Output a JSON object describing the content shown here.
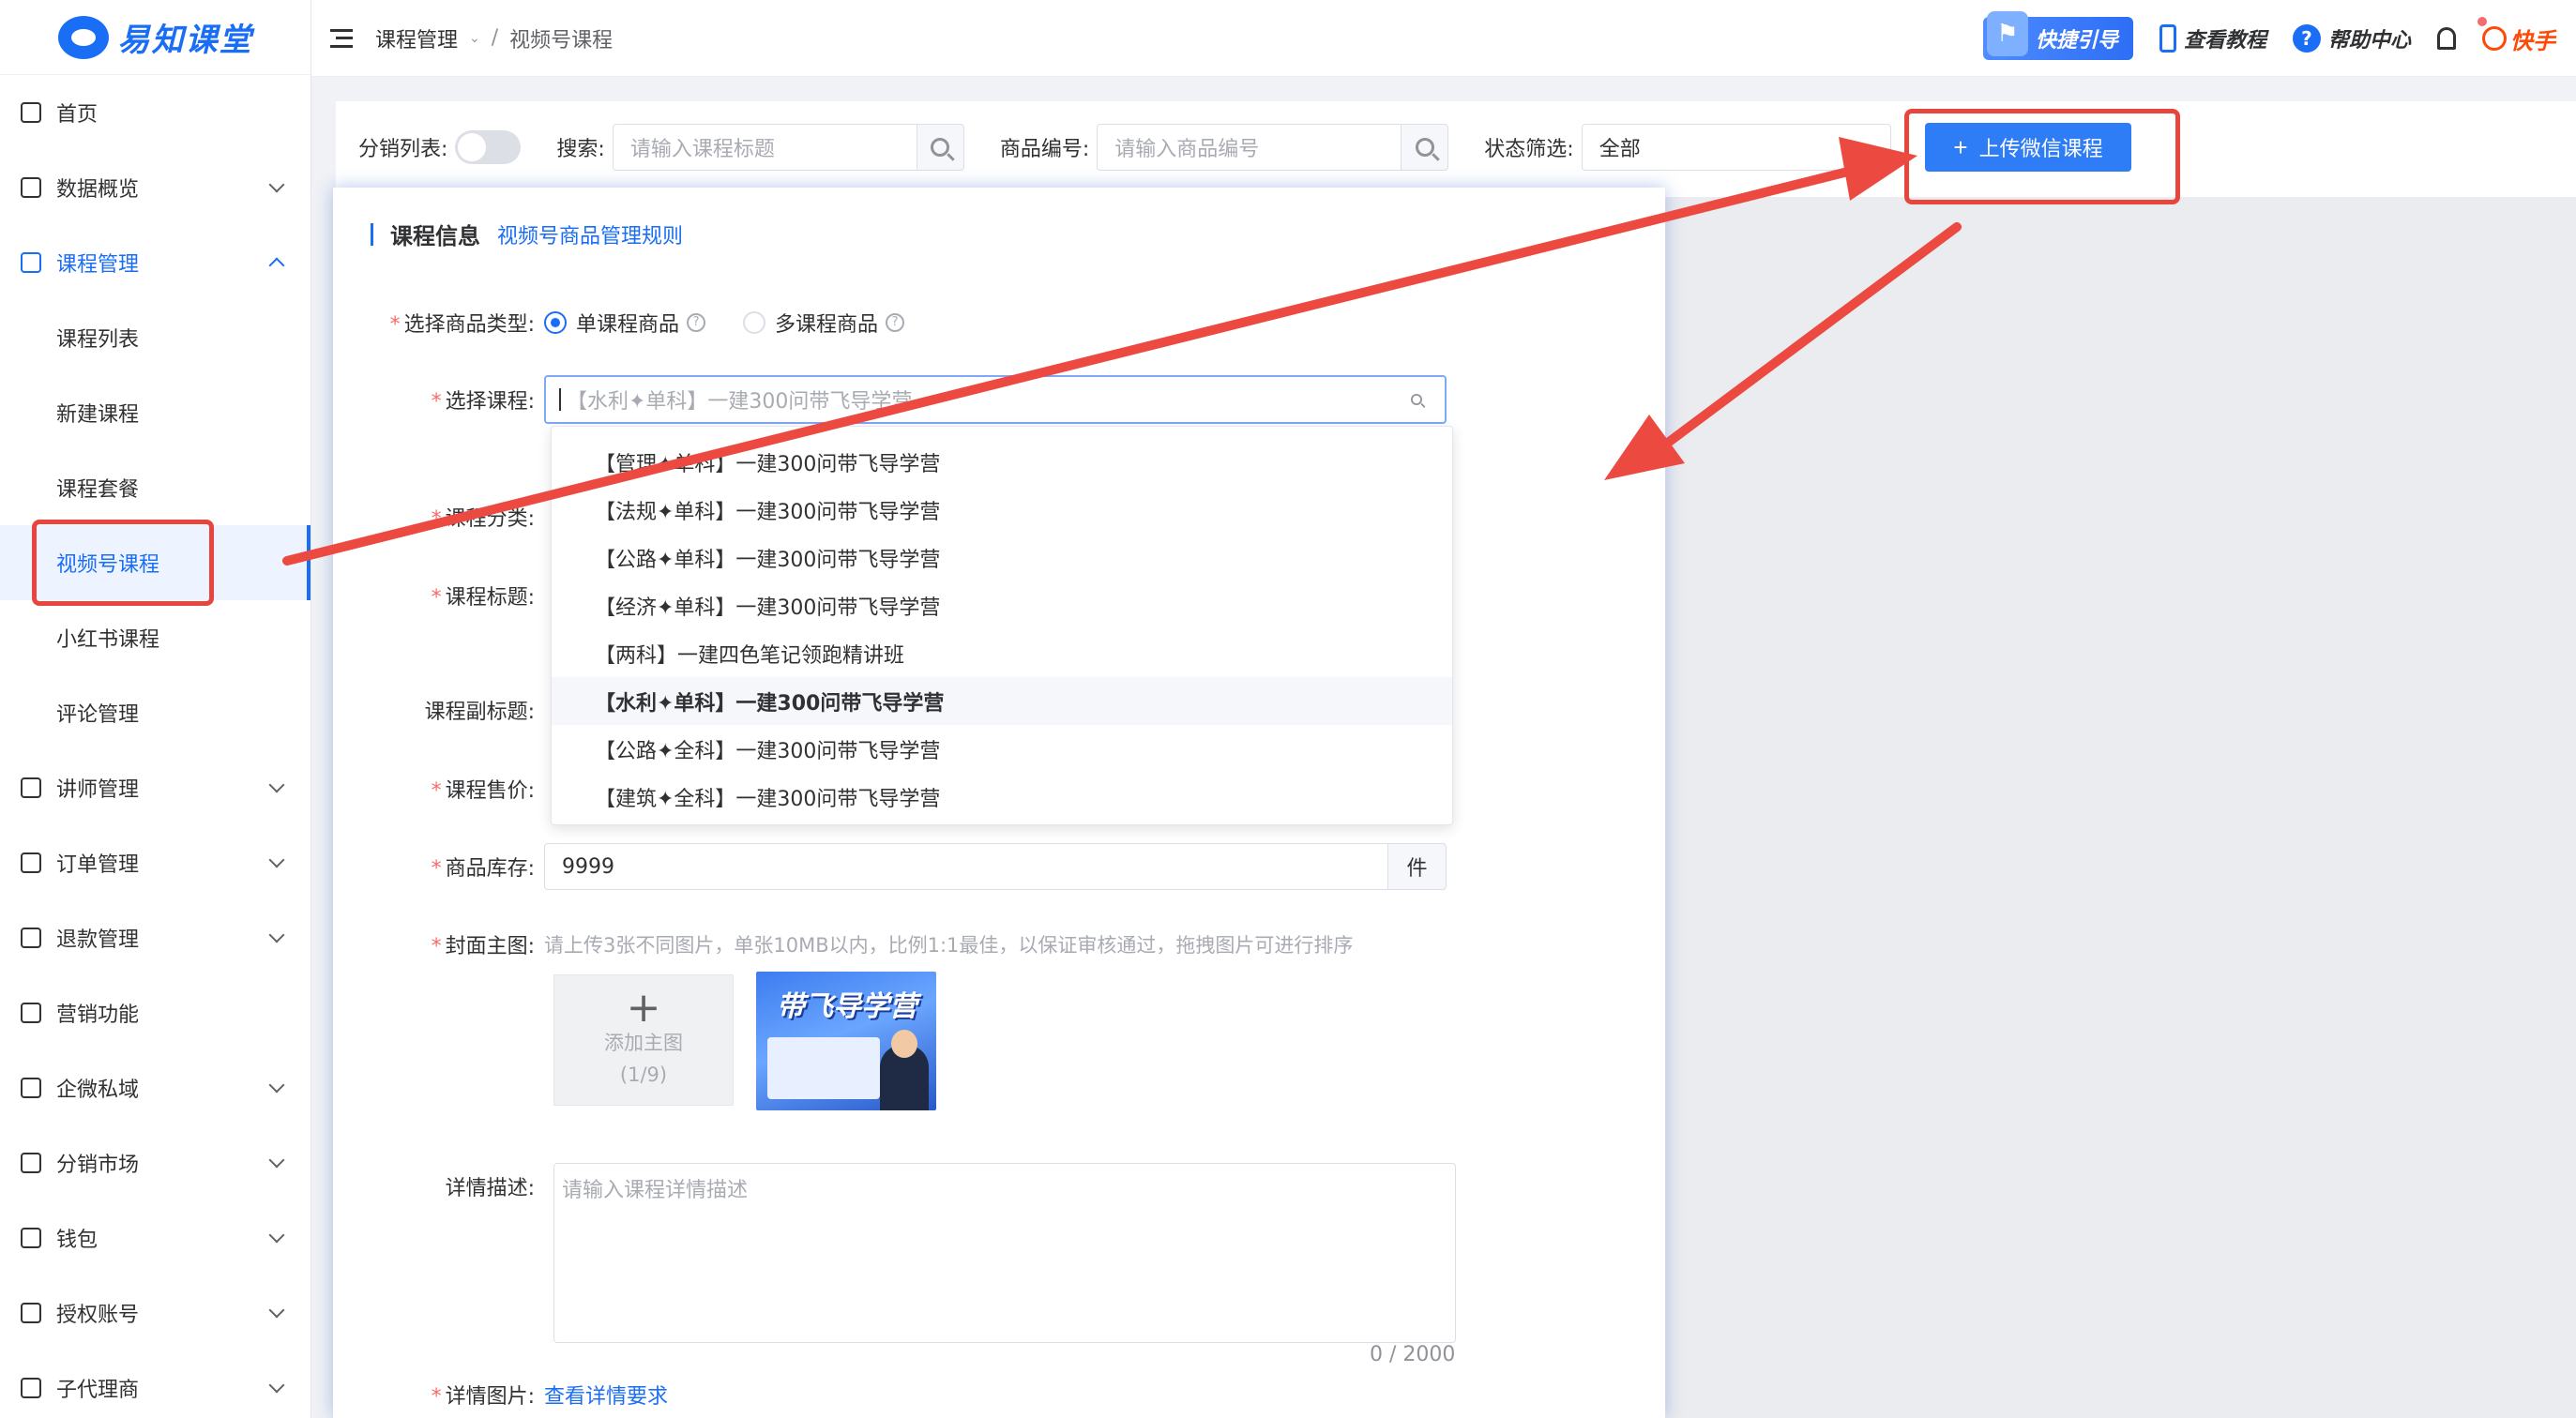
{
  "app": {
    "logo_text": "易知课堂"
  },
  "sidebar": {
    "items": [
      {
        "label": "首页",
        "icon": "home-icon",
        "expandable": false
      },
      {
        "label": "数据概览",
        "icon": "chart-icon",
        "expandable": true
      },
      {
        "label": "课程管理",
        "icon": "grid-icon",
        "expandable": true,
        "expanded": true
      },
      {
        "label": "讲师管理",
        "icon": "teacher-icon",
        "expandable": true
      },
      {
        "label": "订单管理",
        "icon": "order-icon",
        "expandable": true
      },
      {
        "label": "退款管理",
        "icon": "refund-icon",
        "expandable": true
      },
      {
        "label": "营销功能",
        "icon": "bag-icon",
        "expandable": false
      },
      {
        "label": "企微私域",
        "icon": "wechat-icon",
        "expandable": true
      },
      {
        "label": "分销市场",
        "icon": "market-icon",
        "expandable": true
      },
      {
        "label": "钱包",
        "icon": "wallet-icon",
        "expandable": true
      },
      {
        "label": "授权账号",
        "icon": "tiktok-icon",
        "expandable": true
      },
      {
        "label": "子代理商",
        "icon": "user-icon",
        "expandable": true
      }
    ],
    "course_sub": [
      "课程列表",
      "新建课程",
      "课程套餐",
      "视频号课程",
      "小红书课程",
      "评论管理"
    ],
    "selected_sub": "视频号课程"
  },
  "topbar": {
    "breadcrumb": [
      "课程管理",
      "视频号课程"
    ],
    "quick_guide": "快捷引导",
    "tutorial": "查看教程",
    "help": "帮助中心",
    "platform": "快手"
  },
  "filters": {
    "distribution_label": "分销列表:",
    "search_label": "搜索:",
    "search_placeholder": "请输入课程标题",
    "product_no_label": "商品编号:",
    "product_no_placeholder": "请输入商品编号",
    "status_label": "状态筛选:",
    "status_value": "全部",
    "upload_button": "上传微信课程"
  },
  "drawer": {
    "title": "课程信息",
    "rules_link": "视频号商品管理规则",
    "product_type_label": "选择商品类型:",
    "product_type_options": [
      "单课程商品",
      "多课程商品"
    ],
    "product_type_selected": "单课程商品",
    "course_label": "选择课程:",
    "course_placeholder": "【水利✦单科】一建300问带飞导学营",
    "category_label": "课程分类:",
    "title_label": "课程标题:",
    "subtitle_label": "课程副标题:",
    "price_label": "课程售价:",
    "dropdown_options": [
      "【管理✦单科】一建300问带飞导学营",
      "【法规✦单科】一建300问带飞导学营",
      "【公路✦单科】一建300问带飞导学营",
      "【经济✦单科】一建300问带飞导学营",
      "【两科】一建四色笔记领跑精讲班",
      "【水利✦单科】一建300问带飞导学营",
      "【公路✦全科】一建300问带飞导学营",
      "【建筑✦全科】一建300问带飞导学营"
    ],
    "dropdown_hover_index": 5,
    "stock_label": "商品库存:",
    "stock_value": "9999",
    "stock_unit": "件",
    "cover_label": "封面主图:",
    "cover_hint": "请上传3张不同图片，单张10MB以内，比例1:1最佳，以保证审核通过，拖拽图片可进行排序",
    "add_cover_label": "添加主图",
    "add_cover_count": "(1/9)",
    "cover_thumb_title": "带飞导学营",
    "detail_label": "详情描述:",
    "detail_placeholder": "请输入课程详情描述",
    "detail_counter": "0 / 2000",
    "detail_images_label": "详情图片:",
    "detail_images_link": "查看详情要求"
  },
  "colors": {
    "primary": "#1a6ef5",
    "annotation_red": "#e8463d",
    "required": "#f56c6c"
  }
}
